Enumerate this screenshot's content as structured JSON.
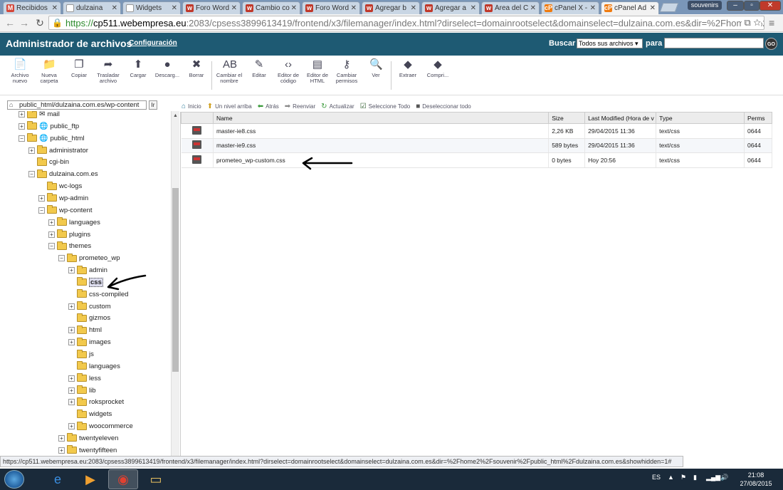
{
  "browser": {
    "tabs": [
      {
        "label": "Recibidos",
        "icon": "gmail-icon",
        "color": "#d44638",
        "glyph": "M"
      },
      {
        "label": "dulzaina",
        "icon": "page-icon",
        "color": "#ffffff",
        "glyph": ""
      },
      {
        "label": "Widgets",
        "icon": "page-icon",
        "color": "#ffffff",
        "glyph": ""
      },
      {
        "label": "Foro Word",
        "icon": "wordpress-es-icon",
        "color": "#c0392b",
        "glyph": "w"
      },
      {
        "label": "Cambio co",
        "icon": "wordpress-es-icon",
        "color": "#c0392b",
        "glyph": "w"
      },
      {
        "label": "Foro Word",
        "icon": "wordpress-es-icon",
        "color": "#c0392b",
        "glyph": "w"
      },
      {
        "label": "Agregar b",
        "icon": "wordpress-es-icon",
        "color": "#c0392b",
        "glyph": "w"
      },
      {
        "label": "Agregar a",
        "icon": "wordpress-es-icon",
        "color": "#c0392b",
        "glyph": "w"
      },
      {
        "label": "Área del C",
        "icon": "wordpress-es-icon",
        "color": "#c0392b",
        "glyph": "w"
      },
      {
        "label": "cPanel X -",
        "icon": "cpanel-icon",
        "color": "#f07b0f",
        "glyph": "cP"
      },
      {
        "label": "cPanel Ad",
        "icon": "cpanel-icon",
        "color": "#f07b0f",
        "glyph": "cP"
      }
    ],
    "active_tab": 10,
    "user": "souvenirs",
    "url_scheme": "https://",
    "url_host": "cp511.webempresa.eu",
    "url_rest": ":2083/cpsess3899613419/frontend/x3/filemanager/index.html?dirselect=domainrootselect&domainselect=dulzaina.com.es&dir=%2Fhome2%2Fso",
    "status_url": "https://cp511.webempresa.eu:2083/cpsess3899613419/frontend/x3/filemanager/index.html?dirselect=domainrootselect&domainselect=dulzaina.com.es&dir=%2Fhome2%2Fsouvenir%2Fpublic_html%2Fdulzaina.com.es&showhidden=1#"
  },
  "header": {
    "title": "Administrador de archivos",
    "config_link": "Configuración",
    "search_label": "Buscar",
    "search_scope": "Todos sus archivos",
    "para_label": "para",
    "search_value": "",
    "go_label": "GO"
  },
  "actions": [
    {
      "label": "Archivo nuevo",
      "name": "new-file-button",
      "icon": "new-file-icon",
      "glyph": "📄"
    },
    {
      "label": "Nueva carpeta",
      "name": "new-folder-button",
      "icon": "new-folder-icon",
      "glyph": "📁"
    },
    {
      "label": "Copiar",
      "name": "copy-button",
      "icon": "copy-icon",
      "glyph": "❐"
    },
    {
      "label": "Trasladar archivo",
      "name": "move-file-button",
      "icon": "move-icon",
      "glyph": "➦"
    },
    {
      "label": "Cargar",
      "name": "upload-button",
      "icon": "upload-icon",
      "glyph": "⬆"
    },
    {
      "label": "Descarg...",
      "name": "download-button",
      "icon": "download-icon",
      "glyph": "●"
    },
    {
      "label": "Borrar",
      "name": "delete-button",
      "icon": "delete-icon",
      "glyph": "✖"
    },
    {
      "label": "Cambiar el nombre",
      "name": "rename-button",
      "icon": "rename-icon",
      "glyph": "AB"
    },
    {
      "label": "Editar",
      "name": "edit-button",
      "icon": "edit-icon",
      "glyph": "✎"
    },
    {
      "label": "Editor de código",
      "name": "code-editor-button",
      "icon": "code-editor-icon",
      "glyph": "‹›"
    },
    {
      "label": "Editor de HTML",
      "name": "html-editor-button",
      "icon": "html-editor-icon",
      "glyph": "▤"
    },
    {
      "label": "Cambiar permisos",
      "name": "permissions-button",
      "icon": "key-icon",
      "glyph": "⚷"
    },
    {
      "label": "Ver",
      "name": "view-button",
      "icon": "magnifier-icon",
      "glyph": "🔍"
    },
    {
      "label": "Extraer",
      "name": "extract-button",
      "icon": "extract-icon",
      "glyph": "◆"
    },
    {
      "label": "Compri...",
      "name": "compress-button",
      "icon": "compress-icon",
      "glyph": "◆"
    }
  ],
  "tree": {
    "path_value": "public_html/dulzaina.com.es/wp-content",
    "go_label": "Ir",
    "nodes": [
      {
        "label": "mail",
        "pm": "+",
        "indent": 0,
        "extra": "✉"
      },
      {
        "label": "public_ftp",
        "pm": "+",
        "indent": 0,
        "extra": "🌐"
      },
      {
        "label": "public_html",
        "pm": "−",
        "indent": 0,
        "extra": "🌐"
      },
      {
        "label": "administrator",
        "pm": "+",
        "indent": 1
      },
      {
        "label": "cgi-bin",
        "pm": "",
        "indent": 1
      },
      {
        "label": "dulzaina.com.es",
        "pm": "−",
        "indent": 1
      },
      {
        "label": "wc-logs",
        "pm": "",
        "indent": 2
      },
      {
        "label": "wp-admin",
        "pm": "+",
        "indent": 2
      },
      {
        "label": "wp-content",
        "pm": "−",
        "indent": 2
      },
      {
        "label": "languages",
        "pm": "+",
        "indent": 3
      },
      {
        "label": "plugins",
        "pm": "+",
        "indent": 3
      },
      {
        "label": "themes",
        "pm": "−",
        "indent": 3
      },
      {
        "label": "prometeo_wp",
        "pm": "−",
        "indent": 4
      },
      {
        "label": "admin",
        "pm": "+",
        "indent": 5
      },
      {
        "label": "css",
        "pm": "",
        "indent": 5,
        "selected": true
      },
      {
        "label": "css-compiled",
        "pm": "",
        "indent": 5
      },
      {
        "label": "custom",
        "pm": "+",
        "indent": 5
      },
      {
        "label": "gizmos",
        "pm": "",
        "indent": 5
      },
      {
        "label": "html",
        "pm": "+",
        "indent": 5
      },
      {
        "label": "images",
        "pm": "+",
        "indent": 5
      },
      {
        "label": "js",
        "pm": "",
        "indent": 5
      },
      {
        "label": "languages",
        "pm": "",
        "indent": 5
      },
      {
        "label": "less",
        "pm": "+",
        "indent": 5
      },
      {
        "label": "lib",
        "pm": "+",
        "indent": 5
      },
      {
        "label": "roksprocket",
        "pm": "+",
        "indent": 5
      },
      {
        "label": "widgets",
        "pm": "",
        "indent": 5
      },
      {
        "label": "woocommerce",
        "pm": "+",
        "indent": 5
      },
      {
        "label": "twentyeleven",
        "pm": "+",
        "indent": 4
      },
      {
        "label": "twentyfifteen",
        "pm": "+",
        "indent": 4
      }
    ]
  },
  "filebar": [
    {
      "label": "Inicio",
      "name": "home-button",
      "icon": "home-icon",
      "glyph": "⌂",
      "color": "#2a7a9a"
    },
    {
      "label": "Un nivel arriba",
      "name": "up-level-button",
      "icon": "up-folder-icon",
      "glyph": "⬆",
      "color": "#d0a020"
    },
    {
      "label": "Atrás",
      "name": "back-button",
      "icon": "back-arrow-icon",
      "glyph": "⬅",
      "color": "#3a9a3a"
    },
    {
      "label": "Reenviar",
      "name": "forward-button",
      "icon": "forward-arrow-icon",
      "glyph": "➡",
      "color": "#888888"
    },
    {
      "label": "Actualizar",
      "name": "refresh-button",
      "icon": "refresh-icon",
      "glyph": "↻",
      "color": "#3a9a3a"
    },
    {
      "label": "Seleccione Todo",
      "name": "select-all-button",
      "icon": "checkbox-checked-icon",
      "glyph": "☑",
      "color": "#2a5a2a"
    },
    {
      "label": "Deseleccionar todo",
      "name": "deselect-all-button",
      "icon": "checkbox-empty-icon",
      "glyph": "■",
      "color": "#555555"
    }
  ],
  "files": {
    "columns": [
      "",
      "Name",
      "Size",
      "Last Modified (Hora de v",
      "Type",
      "Perms"
    ],
    "rows": [
      {
        "name": "master-ie8.css",
        "size": "2,26 KB",
        "modified": "29/04/2015 11:36",
        "type": "text/css",
        "perms": "0644"
      },
      {
        "name": "master-ie9.css",
        "size": "589 bytes",
        "modified": "29/04/2015 11:36",
        "type": "text/css",
        "perms": "0644"
      },
      {
        "name": "prometeo_wp-custom.css",
        "size": "0 bytes",
        "modified": "Hoy 20:56",
        "type": "text/css",
        "perms": "0644"
      }
    ]
  },
  "taskbar": {
    "lang": "ES",
    "time": "21:08",
    "date": "27/08/2015"
  }
}
